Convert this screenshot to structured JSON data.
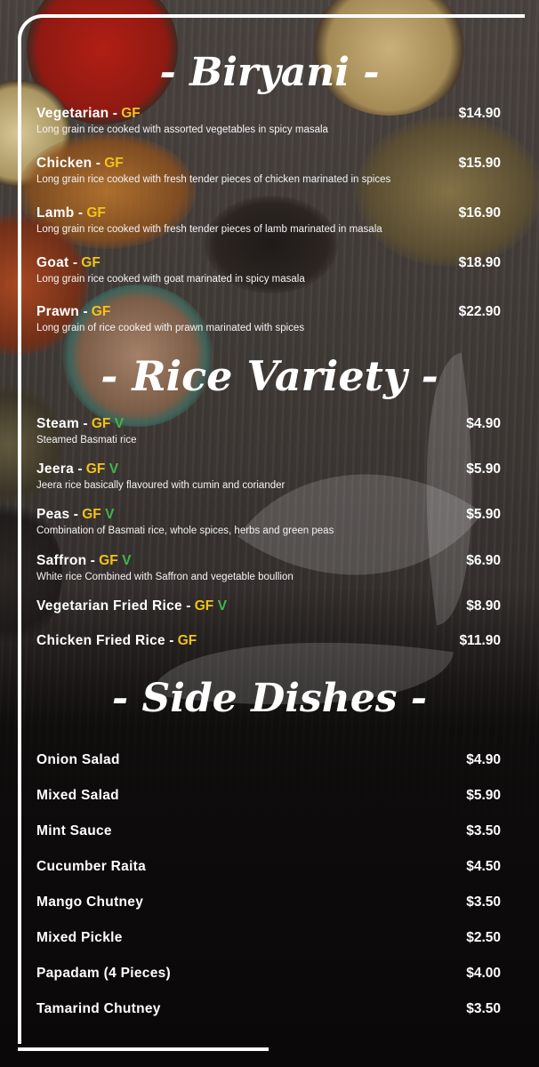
{
  "sections": {
    "biryani": {
      "title": "- Biryani -",
      "items": [
        {
          "name": "Vegetarian",
          "sep": " - ",
          "gf": "GF",
          "desc": "Long grain rice cooked with assorted vegetables in spicy masala",
          "price": "$14.90"
        },
        {
          "name": "Chicken",
          "sep": " - ",
          "gf": "GF",
          "desc": "Long grain rice cooked with fresh tender pieces of chicken marinated in spices",
          "price": "$15.90"
        },
        {
          "name": "Lamb",
          "sep": " - ",
          "gf": "GF",
          "desc": "Long grain rice cooked with fresh tender pieces of lamb marinated in masala",
          "price": "$16.90"
        },
        {
          "name": "Goat",
          "sep": " - ",
          "gf": "GF",
          "desc": "Long grain rice cooked with goat marinated in spicy masala",
          "price": "$18.90"
        },
        {
          "name": "Prawn",
          "sep": " - ",
          "gf": "GF",
          "desc": "Long grain of rice cooked with prawn marinated with spices",
          "price": "$22.90"
        }
      ]
    },
    "rice_variety": {
      "title": "- Rice Variety -",
      "items": [
        {
          "name": "Steam",
          "sep": " - ",
          "gf": "GF",
          "veg": "V",
          "desc": "Steamed Basmati rice",
          "price": "$4.90"
        },
        {
          "name": "Jeera",
          "sep": " - ",
          "gf": "GF",
          "veg": "V",
          "desc": "Jeera rice basically flavoured with cumin and coriander",
          "price": "$5.90"
        },
        {
          "name": "Peas",
          "sep": " - ",
          "gf": "GF",
          "veg": "V",
          "desc": "Combination of Basmati rice, whole spices, herbs and green peas",
          "price": "$5.90"
        },
        {
          "name": "Saffron",
          "sep": " - ",
          "gf": "GF",
          "veg": "V",
          "desc": "White rice Combined with Saffron and vegetable boullion",
          "price": "$6.90"
        },
        {
          "name": "Vegetarian Fried Rice",
          "sep": " - ",
          "gf": "GF",
          "veg": "V",
          "price": "$8.90"
        },
        {
          "name": "Chicken Fried Rice",
          "sep": " - ",
          "gf": "GF",
          "price": "$11.90"
        }
      ]
    },
    "side_dishes": {
      "title": "- Side Dishes -",
      "items": [
        {
          "name": "Onion Salad",
          "price": "$4.90"
        },
        {
          "name": "Mixed Salad",
          "price": "$5.90"
        },
        {
          "name": "Mint Sauce",
          "price": "$3.50"
        },
        {
          "name": "Cucumber Raita",
          "price": "$4.50"
        },
        {
          "name": "Mango Chutney",
          "price": "$3.50"
        },
        {
          "name": "Mixed Pickle",
          "price": "$2.50"
        },
        {
          "name": "Papadam (4 Pieces)",
          "price": "$4.00"
        },
        {
          "name": "Tamarind Chutney",
          "price": "$3.50"
        }
      ]
    }
  },
  "colors": {
    "gf_tag": "#f2c318",
    "veg_tag": "#43b649",
    "text": "#ffffff",
    "background": "#0d0b0b"
  }
}
